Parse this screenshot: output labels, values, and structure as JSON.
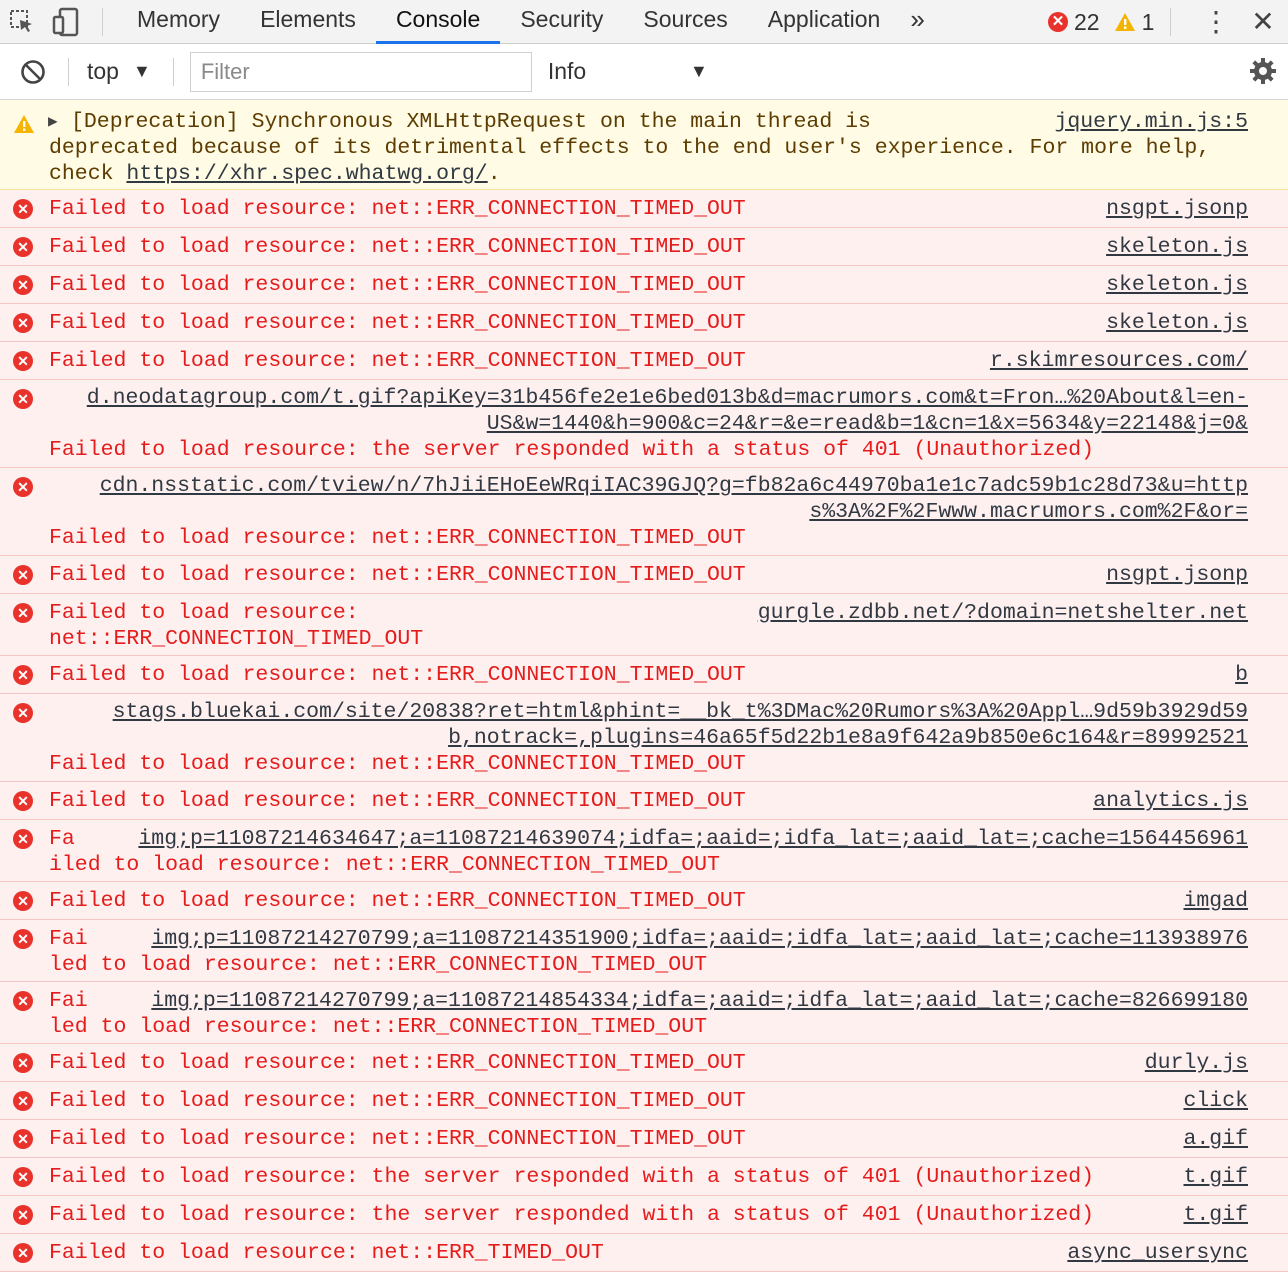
{
  "tabs": [
    "Memory",
    "Elements",
    "Console",
    "Security",
    "Sources",
    "Application"
  ],
  "more_tabs": "»",
  "error_count": "22",
  "warning_count": "1",
  "toolbar": {
    "context": "top",
    "filter_placeholder": "Filter",
    "level": "Info"
  },
  "warning": {
    "line1": "[Deprecation] Synchronous XMLHttpRequest on the main thread is",
    "source": "jquery.min.js:5",
    "line2": "deprecated because of its detrimental effects to the end user's experience. For more help,",
    "line3_prefix": "check ",
    "line3_link": "https://xhr.spec.whatwg.org/",
    "line3_suffix": "."
  },
  "messages": {
    "m1": {
      "text": "Failed to load resource: net::ERR_CONNECTION_TIMED_OUT",
      "source": "nsgpt.jsonp"
    },
    "m2": {
      "text": "Failed to load resource: net::ERR_CONNECTION_TIMED_OUT",
      "source": "skeleton.js"
    },
    "m3": {
      "text": "Failed to load resource: net::ERR_CONNECTION_TIMED_OUT",
      "source": "skeleton.js"
    },
    "m4": {
      "text": "Failed to load resource: net::ERR_CONNECTION_TIMED_OUT",
      "source": "skeleton.js"
    },
    "m5": {
      "text": "Failed to load resource: net::ERR_CONNECTION_TIMED_OUT",
      "source": "r.skimresources.com/"
    },
    "m6": {
      "url1": "d.neodatagroup.com/t.gif?apiKey=31b456fe2e1e6bed013b&d=macrumors.com&t=Fron…%20About&l=en-",
      "url2": "US&w=1440&h=900&c=24&r=&e=read&b=1&cn=1&x=5634&y=22148&j=0&",
      "text": "Failed to load resource: the server responded with a status of 401 (Unauthorized)"
    },
    "m7": {
      "url1": "cdn.nsstatic.com/tview/n/7hJiiEHoEeWRqiIAC39GJQ?g=fb82a6c44970ba1e1c7adc59b1c28d73&u=http",
      "url2": "s%3A%2F%2Fwww.macrumors.com%2F&or=",
      "text": "Failed to load resource: net::ERR_CONNECTION_TIMED_OUT"
    },
    "m8": {
      "text": "Failed to load resource: net::ERR_CONNECTION_TIMED_OUT",
      "source": "nsgpt.jsonp"
    },
    "m9": {
      "text1": "Failed to load resource:",
      "text2": "net::ERR_CONNECTION_TIMED_OUT",
      "source": "gurgle.zdbb.net/?domain=netshelter.net"
    },
    "m10": {
      "text": "Failed to load resource: net::ERR_CONNECTION_TIMED_OUT",
      "source": "b"
    },
    "m11": {
      "url1": "stags.bluekai.com/site/20838?ret=html&phint=__bk_t%3DMac%20Rumors%3A%20Appl…9d59b3929d59",
      "url2": "b,notrack=,plugins=46a65f5d22b1e8a9f642a9b850e6c164&r=89992521",
      "text": "Failed to load resource: net::ERR_CONNECTION_TIMED_OUT"
    },
    "m12": {
      "text": "Failed to load resource: net::ERR_CONNECTION_TIMED_OUT",
      "source": "analytics.js"
    },
    "m13": {
      "prefix": "Fa",
      "url": "img;p=11087214634647;a=11087214639074;idfa=;aaid=;idfa_lat=;aaid_lat=;cache=1564456961",
      "rest": "iled to load resource: net::ERR_CONNECTION_TIMED_OUT"
    },
    "m14": {
      "text": "Failed to load resource: net::ERR_CONNECTION_TIMED_OUT",
      "source": "imgad"
    },
    "m15": {
      "prefix": "Fai",
      "url": "img;p=11087214270799;a=11087214351900;idfa=;aaid=;idfa_lat=;aaid_lat=;cache=113938976",
      "rest": "led to load resource: net::ERR_CONNECTION_TIMED_OUT"
    },
    "m16": {
      "prefix": "Fai",
      "url": "img;p=11087214270799;a=11087214854334;idfa=;aaid=;idfa_lat=;aaid_lat=;cache=826699180",
      "rest": "led to load resource: net::ERR_CONNECTION_TIMED_OUT"
    },
    "m17": {
      "text": "Failed to load resource: net::ERR_CONNECTION_TIMED_OUT",
      "source": "durly.js"
    },
    "m18": {
      "text": "Failed to load resource: net::ERR_CONNECTION_TIMED_OUT",
      "source": "click"
    },
    "m19": {
      "text": "Failed to load resource: net::ERR_CONNECTION_TIMED_OUT",
      "source": "a.gif"
    },
    "m20": {
      "text": "Failed to load resource: the server responded with a status of 401 (Unauthorized)",
      "source": "t.gif"
    },
    "m21": {
      "text": "Failed to load resource: the server responded with a status of 401 (Unauthorized)",
      "source": "t.gif"
    },
    "m22": {
      "text": "Failed to load resource: net::ERR_TIMED_OUT",
      "source": "async_usersync"
    }
  }
}
